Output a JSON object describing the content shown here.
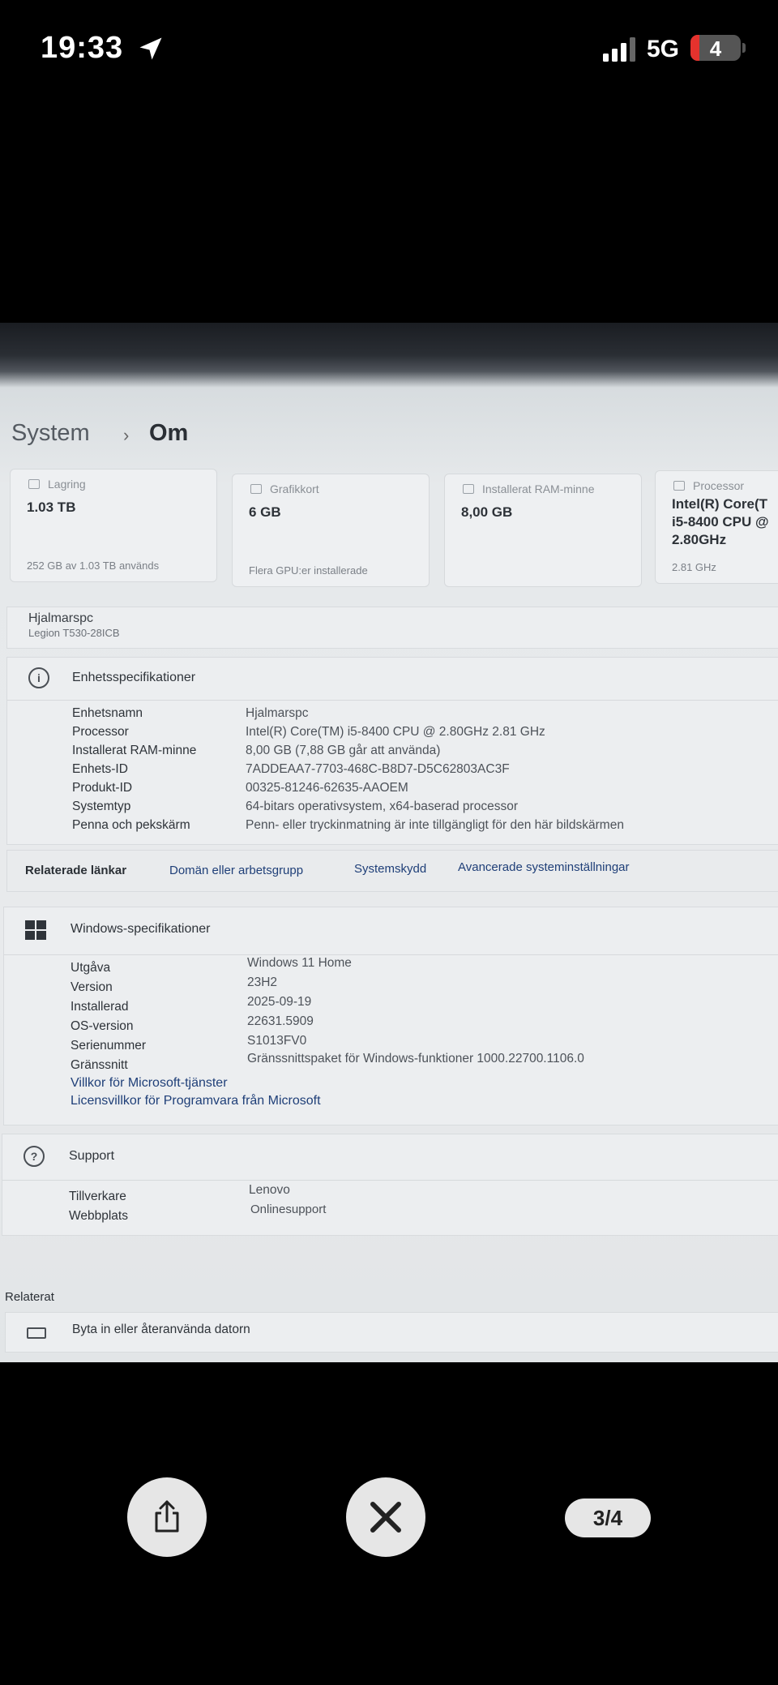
{
  "status_bar": {
    "time": "19:33",
    "network": "5G",
    "battery": "4"
  },
  "breadcrumb": {
    "root": "System",
    "separator": "›",
    "current": "Om"
  },
  "cards": [
    {
      "label": "Lagring",
      "value": "1.03 TB",
      "sub": "252 GB av 1.03 TB används"
    },
    {
      "label": "Grafikkort",
      "value": "6 GB",
      "sub": "Flera GPU:er installerade"
    },
    {
      "label": "Installerat RAM-minne",
      "value": "8,00 GB",
      "sub": ""
    },
    {
      "label": "Processor",
      "value": "Intel(R) Core(T\ni5-8400 CPU @\n2.80GHz",
      "sub": "2.81 GHz"
    }
  ],
  "device": {
    "name": "Hjalmarspc",
    "model": "Legion T530-28ICB"
  },
  "device_specs": {
    "title": "Enhetsspecifikationer",
    "rows": [
      {
        "key": "Enhetsnamn",
        "value": "Hjalmarspc"
      },
      {
        "key": "Processor",
        "value": "Intel(R) Core(TM) i5-8400 CPU @ 2.80GHz   2.81 GHz"
      },
      {
        "key": "Installerat RAM-minne",
        "value": "8,00 GB (7,88 GB går att använda)"
      },
      {
        "key": "Enhets-ID",
        "value": "7ADDEAA7-7703-468C-B8D7-D5C62803AC3F"
      },
      {
        "key": "Produkt-ID",
        "value": "00325-81246-62635-AAOEM"
      },
      {
        "key": "Systemtyp",
        "value": "64-bitars operativsystem, x64-baserad processor"
      },
      {
        "key": "Penna och pekskärm",
        "value": "Penn- eller tryckinmatning är inte tillgängligt för den här bildskärmen"
      }
    ]
  },
  "related_links": {
    "label": "Relaterade länkar",
    "links": [
      "Domän eller arbetsgrupp",
      "Systemskydd",
      "Avancerade systeminställningar"
    ]
  },
  "windows_specs": {
    "title": "Windows-specifikationer",
    "rows": [
      {
        "key": "Utgåva",
        "value": "Windows 11 Home"
      },
      {
        "key": "Version",
        "value": "23H2"
      },
      {
        "key": "Installerad",
        "value": "2025-09-19"
      },
      {
        "key": "OS-version",
        "value": "22631.5909"
      },
      {
        "key": "Serienummer",
        "value": "S1013FV0"
      },
      {
        "key": "Gränssnitt",
        "value": "Gränssnittspaket för Windows-funktioner 1000.22700.1106.0"
      }
    ],
    "links": [
      "Villkor för Microsoft-tjänster",
      "Licensvillkor för Programvara från Microsoft"
    ]
  },
  "support": {
    "title": "Support",
    "rows": [
      {
        "key": "Tillverkare",
        "value": "Lenovo"
      },
      {
        "key": "Webbplats",
        "value": "Onlinesupport"
      }
    ]
  },
  "related": {
    "label": "Relaterat",
    "item": "Byta in eller återanvända datorn"
  },
  "viewer": {
    "pager": "3/4"
  }
}
